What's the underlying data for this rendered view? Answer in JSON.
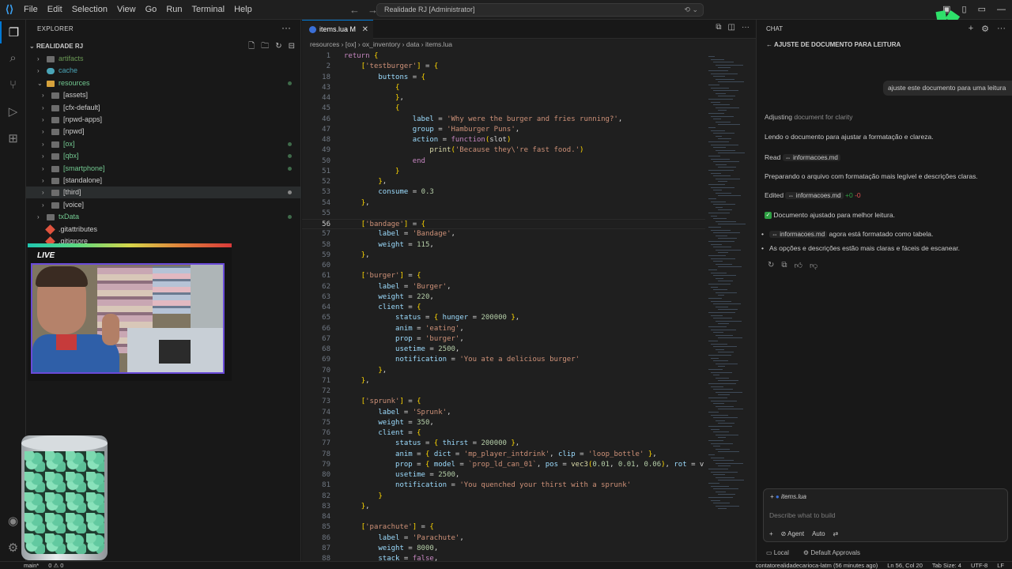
{
  "menu": [
    "File",
    "Edit",
    "Selection",
    "View",
    "Go",
    "Run",
    "Terminal",
    "Help"
  ],
  "command_center": "Realidade RJ [Administrator]",
  "explorer": {
    "title": "EXPLORER",
    "root": "REALIDADE RJ",
    "items": [
      {
        "label": "artifacts",
        "color": "#6a9955",
        "dot": "",
        "open": false,
        "depth": 0,
        "kind": "folder"
      },
      {
        "label": "cache",
        "color": "#4aa5b8",
        "dot": "",
        "open": false,
        "depth": 0,
        "kind": "cache"
      },
      {
        "label": "resources",
        "color": "#73c991",
        "dot": "#3f6b4a",
        "open": true,
        "depth": 0,
        "kind": "folder"
      },
      {
        "label": "[assets]",
        "color": "#cccccc",
        "dot": "",
        "open": false,
        "depth": 1,
        "kind": "folder"
      },
      {
        "label": "[cfx-default]",
        "color": "#cccccc",
        "dot": "",
        "open": false,
        "depth": 1,
        "kind": "folder"
      },
      {
        "label": "[npwd-apps]",
        "color": "#cccccc",
        "dot": "",
        "open": false,
        "depth": 1,
        "kind": "folder"
      },
      {
        "label": "[npwd]",
        "color": "#cccccc",
        "dot": "",
        "open": false,
        "depth": 1,
        "kind": "folder"
      },
      {
        "label": "[ox]",
        "color": "#73c991",
        "dot": "#3f6b4a",
        "open": false,
        "depth": 1,
        "kind": "folder"
      },
      {
        "label": "[qbx]",
        "color": "#73c991",
        "dot": "#3f6b4a",
        "open": false,
        "depth": 1,
        "kind": "folder"
      },
      {
        "label": "[smartphone]",
        "color": "#73c991",
        "dot": "#3f6b4a",
        "open": false,
        "depth": 1,
        "kind": "folder"
      },
      {
        "label": "[standalone]",
        "color": "#cccccc",
        "dot": "",
        "open": false,
        "depth": 1,
        "kind": "folder"
      },
      {
        "label": "[third]",
        "color": "#cccccc",
        "dot": "#888888",
        "open": false,
        "depth": 1,
        "kind": "folder",
        "selected": true
      },
      {
        "label": "[voice]",
        "color": "#cccccc",
        "dot": "",
        "open": false,
        "depth": 1,
        "kind": "folder"
      },
      {
        "label": "txData",
        "color": "#73c991",
        "dot": "#3f6b4a",
        "open": false,
        "depth": 0,
        "kind": "folder"
      },
      {
        "label": ".gitattributes",
        "color": "#cccccc",
        "dot": "",
        "open": false,
        "depth": 0,
        "kind": "git"
      },
      {
        "label": ".gitignore",
        "color": "#cccccc",
        "dot": "",
        "open": false,
        "depth": 0,
        "kind": "git"
      }
    ]
  },
  "webcam": {
    "live_label": "LIVE"
  },
  "editor": {
    "tab_label": "items.lua M",
    "breadcrumb": "resources › [ox] › ox_inventory › data › items.lua",
    "current_line": 56,
    "lines": [
      {
        "n": "1",
        "t": "return {"
      },
      {
        "n": "2",
        "t": "    ['testburger'] = {"
      },
      {
        "n": "18",
        "t": "        buttons = {"
      },
      {
        "n": "43",
        "t": "            {"
      },
      {
        "n": "44",
        "t": "            },"
      },
      {
        "n": "45",
        "t": "            {"
      },
      {
        "n": "46",
        "t": "                label = 'Why were the burger and fries running?',"
      },
      {
        "n": "47",
        "t": "                group = 'Hamburger Puns',"
      },
      {
        "n": "48",
        "t": "                action = function(slot)"
      },
      {
        "n": "49",
        "t": "                    print('Because they\\'re fast food.')"
      },
      {
        "n": "50",
        "t": "                end"
      },
      {
        "n": "51",
        "t": "            }"
      },
      {
        "n": "52",
        "t": "        },"
      },
      {
        "n": "53",
        "t": "        consume = 0.3"
      },
      {
        "n": "54",
        "t": "    },"
      },
      {
        "n": "55",
        "t": ""
      },
      {
        "n": "56",
        "t": "    ['bandage'] = {"
      },
      {
        "n": "57",
        "t": "        label = 'Bandage',"
      },
      {
        "n": "58",
        "t": "        weight = 115,"
      },
      {
        "n": "59",
        "t": "    },"
      },
      {
        "n": "60",
        "t": ""
      },
      {
        "n": "61",
        "t": "    ['burger'] = {"
      },
      {
        "n": "62",
        "t": "        label = 'Burger',"
      },
      {
        "n": "63",
        "t": "        weight = 220,"
      },
      {
        "n": "64",
        "t": "        client = {"
      },
      {
        "n": "65",
        "t": "            status = { hunger = 200000 },"
      },
      {
        "n": "66",
        "t": "            anim = 'eating',"
      },
      {
        "n": "67",
        "t": "            prop = 'burger',"
      },
      {
        "n": "68",
        "t": "            usetime = 2500,"
      },
      {
        "n": "69",
        "t": "            notification = 'You ate a delicious burger'"
      },
      {
        "n": "70",
        "t": "        },"
      },
      {
        "n": "71",
        "t": "    },"
      },
      {
        "n": "72",
        "t": ""
      },
      {
        "n": "73",
        "t": "    ['sprunk'] = {"
      },
      {
        "n": "74",
        "t": "        label = 'Sprunk',"
      },
      {
        "n": "75",
        "t": "        weight = 350,"
      },
      {
        "n": "76",
        "t": "        client = {"
      },
      {
        "n": "77",
        "t": "            status = { thirst = 200000 },"
      },
      {
        "n": "78",
        "t": "            anim = { dict = 'mp_player_intdrink', clip = 'loop_bottle' },"
      },
      {
        "n": "79",
        "t": "            prop = { model = `prop_ld_can_01`, pos = vec3(0.01, 0.01, 0.06), rot = v"
      },
      {
        "n": "80",
        "t": "            usetime = 2500,"
      },
      {
        "n": "81",
        "t": "            notification = 'You quenched your thirst with a sprunk'"
      },
      {
        "n": "82",
        "t": "        }"
      },
      {
        "n": "83",
        "t": "    },"
      },
      {
        "n": "84",
        "t": ""
      },
      {
        "n": "85",
        "t": "    ['parachute'] = {"
      },
      {
        "n": "86",
        "t": "        label = 'Parachute',"
      },
      {
        "n": "87",
        "t": "        weight = 8000,"
      },
      {
        "n": "88",
        "t": "        stack = false,"
      }
    ]
  },
  "chat": {
    "header": "CHAT",
    "title": "AJUSTE DE DOCUMENTO PARA LEITURA",
    "user_message": "ajuste este documento para uma leitura",
    "adjusting_label": "Adjusting",
    "adjusting_rest": "document for clarity",
    "msg1": "Lendo o documento para ajustar a formatação e clareza.",
    "read_label": "Read",
    "read_file": "informacoes.md",
    "msg2": "Preparando o arquivo com formatação mais legível e descrições claras.",
    "edited_label": "Edited",
    "edited_file": "informacoes.md",
    "edited_plus": "+0",
    "edited_minus": "-0",
    "done": "Documento ajustado para melhor leitura.",
    "bullet1_file": "informacoes.md",
    "bullet1_rest": "agora está formatado como tabela.",
    "bullet2": "As opções e descrições estão mais claras e fáceis de escanear.",
    "composer_context": "items.lua",
    "composer_placeholder": "Describe what to build",
    "agent_label": "Agent",
    "auto_label": "Auto",
    "local_label": "Local",
    "approvals_label": "Default Approvals"
  },
  "status": {
    "branch": "main*",
    "problems": "0 ⚠ 0",
    "user": "contatorealidadecarioca-latm (56 minutes ago)",
    "position": "Ln 56, Col 20",
    "tab_size": "Tab Size: 4",
    "encoding": "UTF-8",
    "eol": "LF"
  }
}
